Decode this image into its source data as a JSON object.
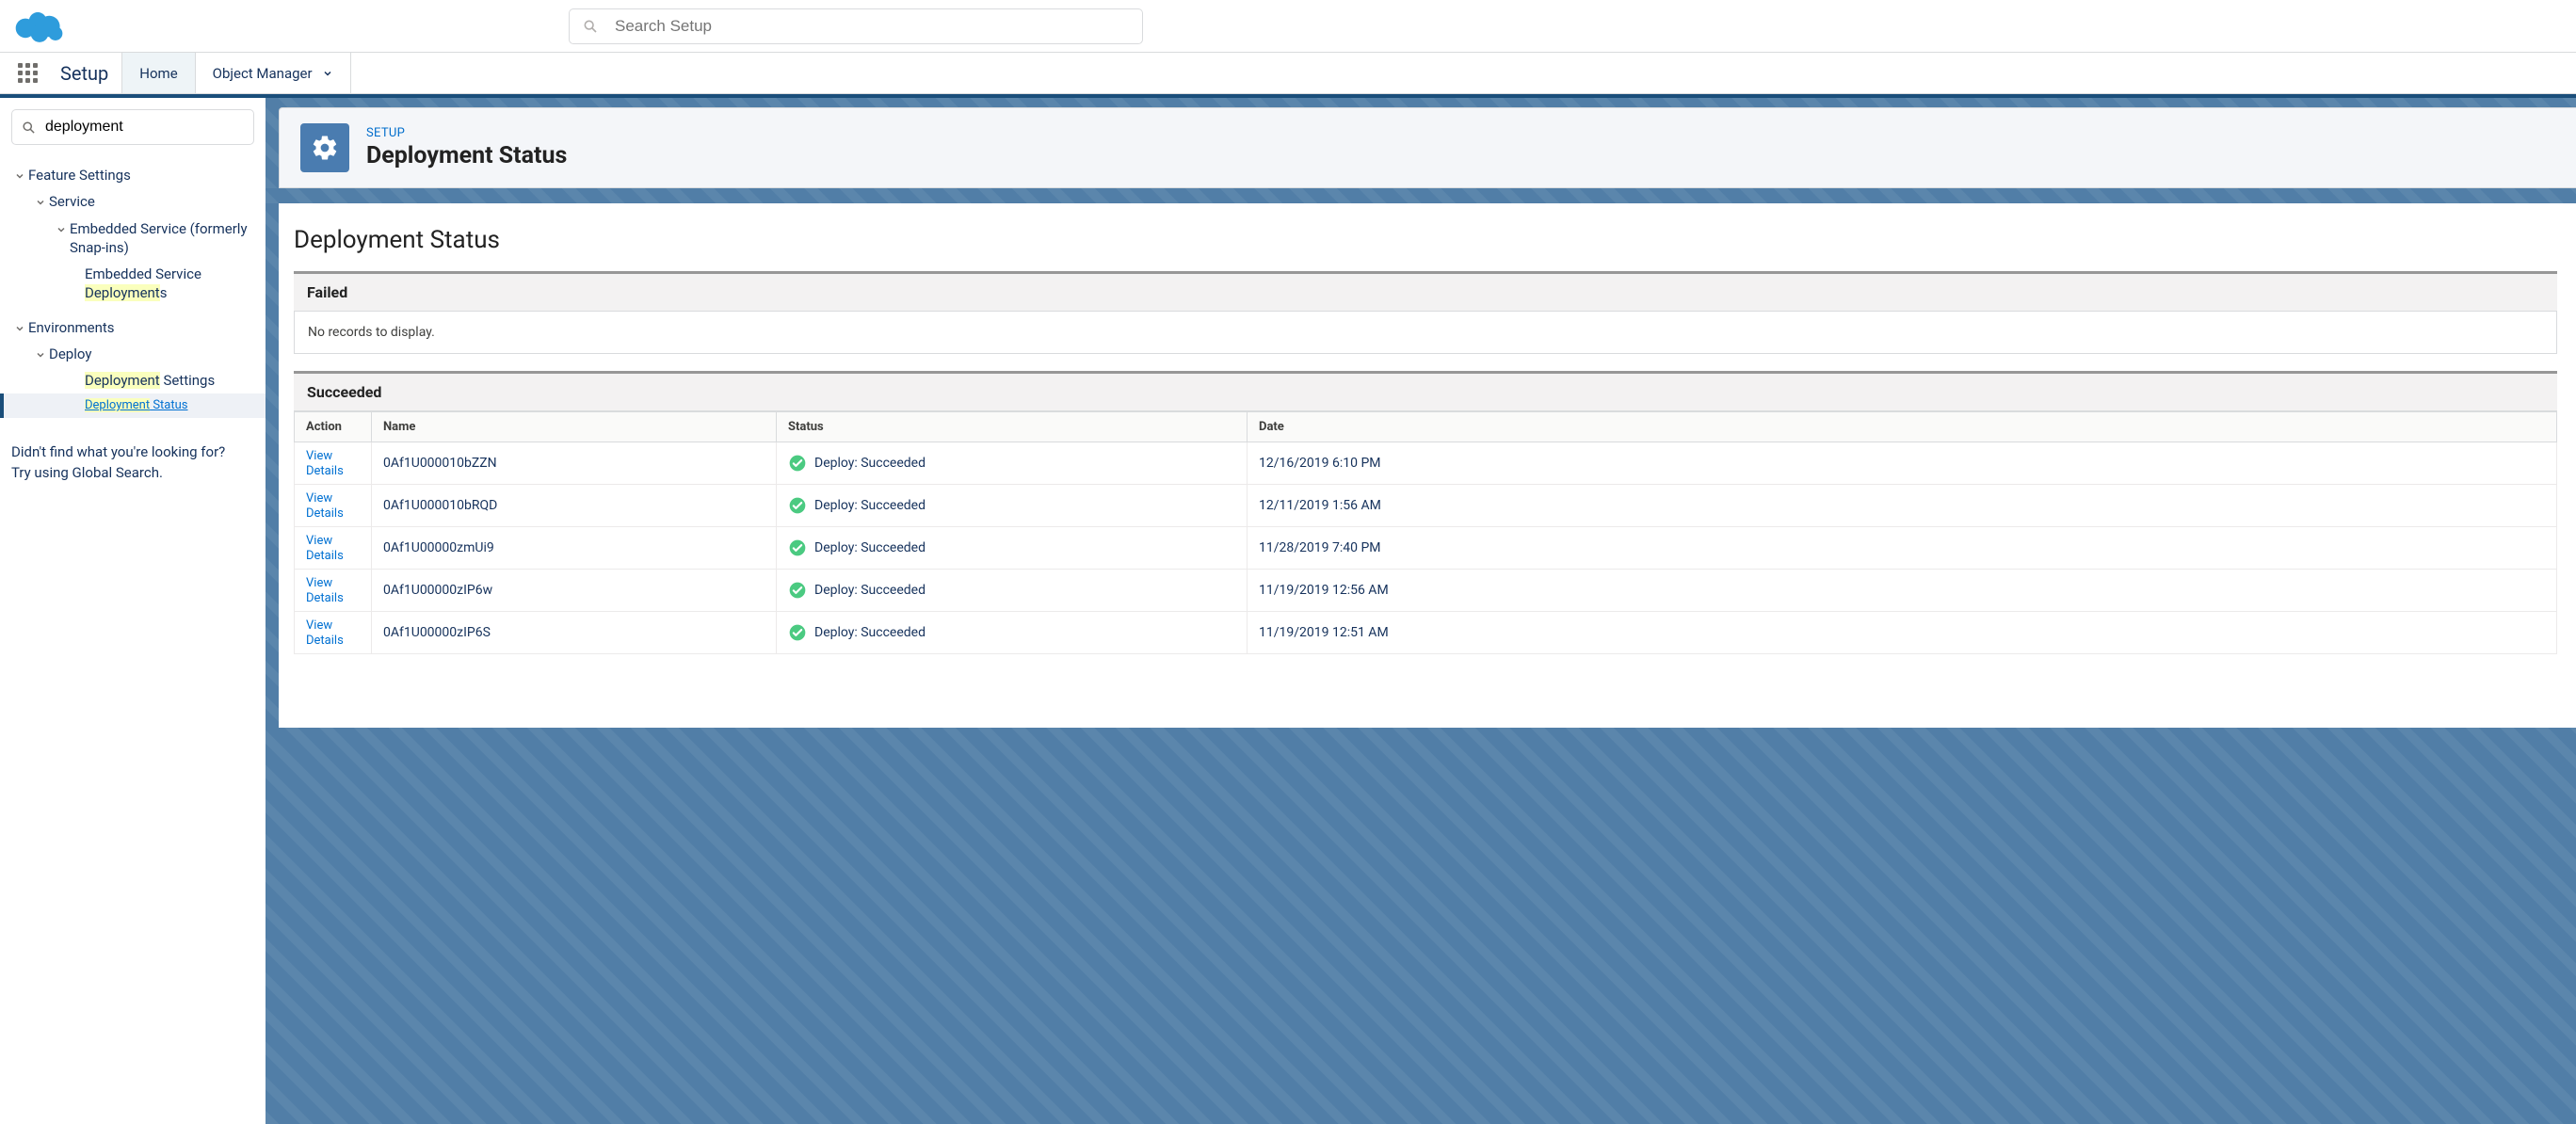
{
  "header": {
    "search_placeholder": "Search Setup"
  },
  "nav": {
    "app_name": "Setup",
    "tabs": [
      {
        "label": "Home"
      },
      {
        "label": "Object Manager"
      }
    ]
  },
  "sidebar": {
    "search_value": "deployment",
    "tree": {
      "feature_settings": "Feature Settings",
      "service": "Service",
      "embedded_service": "Embedded Service (formerly Snap-ins)",
      "embedded_service_deployments_pre": "Embedded Service ",
      "embedded_service_deployments_hl": "Deployment",
      "embedded_service_deployments_post": "s",
      "environments": "Environments",
      "deploy": "Deploy",
      "deployment_settings_hl": "Deployment",
      "deployment_settings_post": " Settings",
      "deployment_status_hl": "Deployment",
      "deployment_status_post": " Status"
    },
    "help_line1": "Didn't find what you're looking for?",
    "help_line2": "Try using Global Search."
  },
  "page": {
    "eyebrow": "SETUP",
    "title": "Deployment Status",
    "body_title": "Deployment Status",
    "failed_header": "Failed",
    "failed_empty": "No records to display.",
    "succeeded_header": "Succeeded",
    "columns": {
      "action": "Action",
      "name": "Name",
      "status": "Status",
      "date": "Date"
    },
    "view_details": "View Details",
    "status_text": "Deploy: Succeeded",
    "rows": [
      {
        "name": "0Af1U000010bZZN",
        "date": "12/16/2019 6:10 PM"
      },
      {
        "name": "0Af1U000010bRQD",
        "date": "12/11/2019 1:56 AM"
      },
      {
        "name": "0Af1U00000zmUi9",
        "date": "11/28/2019 7:40 PM"
      },
      {
        "name": "0Af1U00000zIP6w",
        "date": "11/19/2019 12:56 AM"
      },
      {
        "name": "0Af1U00000zIP6S",
        "date": "11/19/2019 12:51 AM"
      }
    ]
  }
}
